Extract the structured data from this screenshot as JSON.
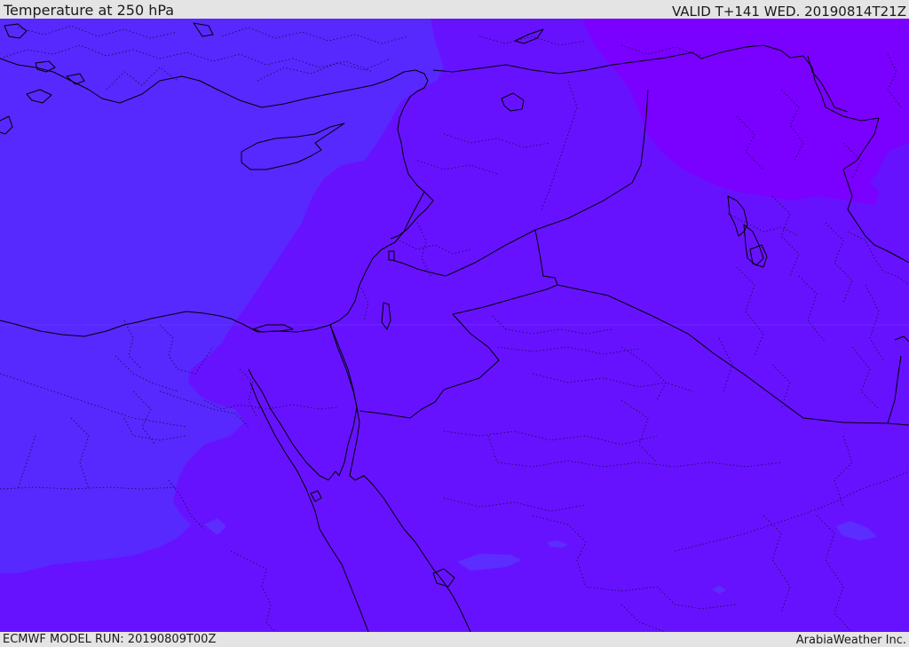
{
  "header": {
    "title": "Temperature at 250 hPa",
    "valid_time": "VALID T+141 WED. 20190814T21Z"
  },
  "footer": {
    "model_run": "ECMWF MODEL RUN: 20190809T00Z",
    "credit": "ArabiaWeather Inc."
  },
  "colors": {
    "frame": "#e4e4e4",
    "zone_cool": "#5729ff",
    "zone_mid": "#6712ff",
    "zone_warm": "#7a00ff",
    "coast_line": "#000000",
    "border_line": "#000000",
    "text": "#1a1a1a"
  }
}
